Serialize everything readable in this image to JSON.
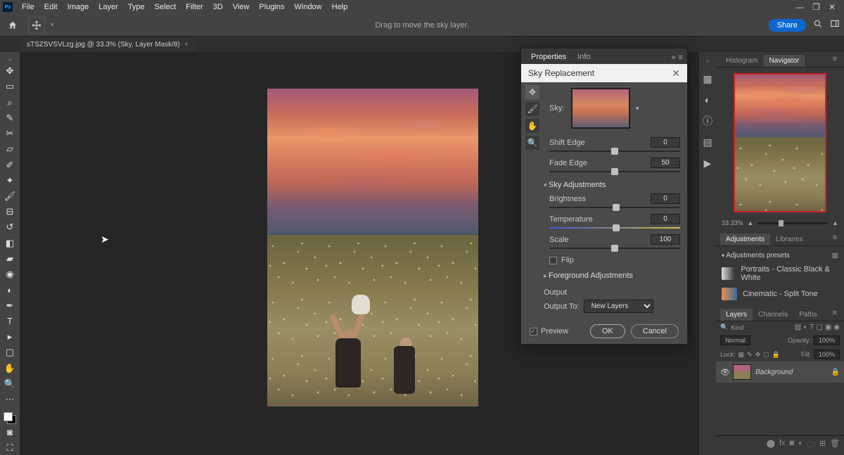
{
  "menu": {
    "items": [
      "File",
      "Edit",
      "Image",
      "Layer",
      "Type",
      "Select",
      "Filter",
      "3D",
      "View",
      "Plugins",
      "Window",
      "Help"
    ]
  },
  "options": {
    "hint": "Drag to move the sky layer.",
    "share": "Share"
  },
  "document": {
    "tab": "sTSZSVSVLzg.jpg @ 33.3% (Sky, Layer Mask/8)"
  },
  "dialog": {
    "tabs": [
      "Properties",
      "Info"
    ],
    "title": "Sky Replacement",
    "sky_label": "Sky:",
    "shift_edge": {
      "label": "Shift Edge",
      "value": "0",
      "pos": 50
    },
    "fade_edge": {
      "label": "Fade Edge",
      "value": "50",
      "pos": 50
    },
    "sky_adjustments": "Sky Adjustments",
    "brightness": {
      "label": "Brightness",
      "value": "0",
      "pos": 51
    },
    "temperature": {
      "label": "Temperature",
      "value": "0",
      "pos": 51
    },
    "scale": {
      "label": "Scale",
      "value": "100",
      "pos": 50
    },
    "flip": "Flip",
    "foreground_adjustments": "Foreground Adjustments",
    "output": "Output",
    "output_to": "Output To:",
    "output_option": "New Layers",
    "preview": "Preview",
    "ok": "OK",
    "cancel": "Cancel"
  },
  "navigator": {
    "tabs": [
      "Histogram",
      "Navigator"
    ],
    "zoom": "33.33%"
  },
  "adjustments": {
    "tabs": [
      "Adjustments",
      "Libraries"
    ],
    "header": "Adjustments presets",
    "presets": [
      "Portraits - Classic Black & White",
      "Cinematic - Split Tone"
    ]
  },
  "layers": {
    "tabs": [
      "Layers",
      "Channels",
      "Paths"
    ],
    "kind_label": "Kind",
    "blend_mode": "Normal",
    "opacity_label": "Opacity:",
    "opacity_value": "100%",
    "lock_label": "Lock:",
    "fill_label": "Fill:",
    "fill_value": "100%",
    "items": [
      {
        "name": "Background"
      }
    ]
  }
}
